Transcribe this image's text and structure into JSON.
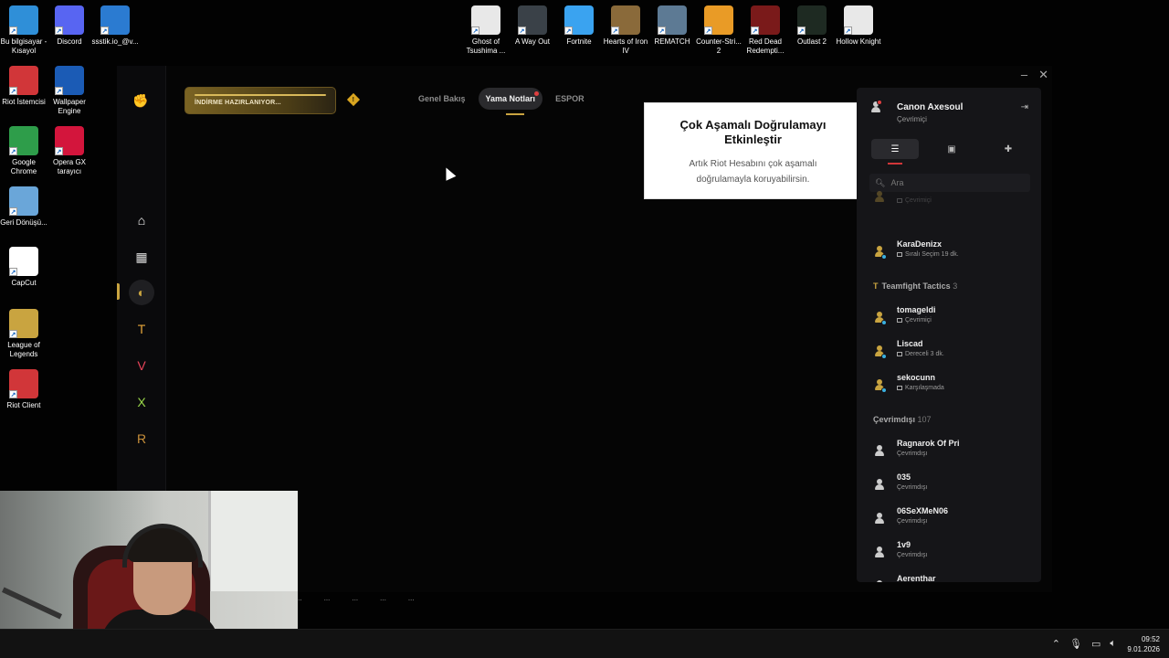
{
  "desktop": {
    "icons_left": [
      {
        "label": "Bu bilgisayar - Kısayol",
        "icon": "computer-icon",
        "color": "#2f8fd8"
      },
      {
        "label": "Discord",
        "icon": "discord-icon",
        "color": "#5865f2"
      },
      {
        "label": "ssstik.io_@v...",
        "icon": "video-file-icon",
        "color": "#2b7bd1"
      },
      {
        "label": "Riot İstemcisi",
        "icon": "riot-icon",
        "color": "#d13639"
      },
      {
        "label": "Wallpaper Engine",
        "icon": "wallpaper-engine-icon",
        "color": "#1b5bb5"
      },
      {
        "label": "Google Chrome",
        "icon": "chrome-icon",
        "color": "#2e9d4a"
      },
      {
        "label": "Opera GX tarayıcı",
        "icon": "opera-gx-icon",
        "color": "#d3153c"
      },
      {
        "label": "Geri Dönüşü...",
        "icon": "recycle-bin-icon",
        "color": "#6aa6d9"
      },
      {
        "label": "CapCut",
        "icon": "capcut-icon",
        "color": "#ffffff"
      },
      {
        "label": "League of Legends",
        "icon": "league-icon",
        "color": "#c9a440"
      },
      {
        "label": "Riot Client",
        "icon": "riot-icon",
        "color": "#d13639"
      }
    ],
    "icons_top": [
      {
        "label": "Ghost of Tsushima ...",
        "icon": "ghost-of-tsushima-icon",
        "color": "#e8e8e8"
      },
      {
        "label": "A Way Out",
        "icon": "a-way-out-icon",
        "color": "#3a4148"
      },
      {
        "label": "Fortnite",
        "icon": "fortnite-icon",
        "color": "#3aa3f0"
      },
      {
        "label": "Hearts of Iron IV",
        "icon": "hearts-of-iron-icon",
        "color": "#8a6a3a"
      },
      {
        "label": "REMATCH",
        "icon": "rematch-icon",
        "color": "#5d7a94"
      },
      {
        "label": "Counter-Stri... 2",
        "icon": "counter-strike-icon",
        "color": "#e99b26"
      },
      {
        "label": "Red Dead Redempti...",
        "icon": "red-dead-icon",
        "color": "#7a1a1a"
      },
      {
        "label": "Outlast 2",
        "icon": "outlast-icon",
        "color": "#1e2a22"
      },
      {
        "label": "Hollow Knight",
        "icon": "hollow-knight-icon",
        "color": "#e8e8e8"
      }
    ]
  },
  "client": {
    "play_button": "İNDİRME HAZIRLANIYOR...",
    "alert_glyph": "!",
    "tabs": [
      {
        "label": "Genel Bakış",
        "active": false,
        "dot": false
      },
      {
        "label": "Yama Notları",
        "active": true,
        "dot": true
      },
      {
        "label": "ESPOR",
        "active": false,
        "dot": false
      }
    ],
    "sidebar": [
      {
        "name": "home",
        "icon": "home-icon",
        "glyph": "⌂",
        "color": "#ffffff"
      },
      {
        "name": "library",
        "icon": "grid-icon",
        "glyph": "▦",
        "color": "#dddddd"
      },
      {
        "name": "league-of-legends",
        "icon": "league-icon",
        "glyph": "◐",
        "color": "#c9a440"
      },
      {
        "name": "teamfight-tactics",
        "icon": "tft-icon",
        "glyph": "T",
        "color": "#e5a53a"
      },
      {
        "name": "valorant",
        "icon": "valorant-icon",
        "glyph": "V",
        "color": "#e8445a"
      },
      {
        "name": "2xko",
        "icon": "2xko-icon",
        "glyph": "X",
        "color": "#9ad94a"
      },
      {
        "name": "legends-of-runeterra",
        "icon": "runeterra-icon",
        "glyph": "R",
        "color": "#c9903a"
      }
    ],
    "mfa_tooltip": {
      "title": "Çok Aşamalı Doğrulamayı Etkinleştir",
      "description": "Artık Riot Hesabını çok aşamalı doğrulamayla koruyabilirsin."
    },
    "bottom_strip": [
      "...",
      "...",
      "...",
      "...",
      "..."
    ]
  },
  "friends_panel": {
    "me": {
      "name": "Canon Axesoul",
      "status": "Çevrimiçi"
    },
    "search_placeholder": "Ara",
    "partial_top": {
      "name": "",
      "status": "Çevrimiçi"
    },
    "entries_a": [
      {
        "name": "KaraDenizx",
        "status": "Sıralı Seçim 19 dk.",
        "status_color": "#3ab0e0"
      }
    ],
    "group_tft": {
      "label": "Teamfight Tactics",
      "count": "3"
    },
    "entries_tft": [
      {
        "name": "tomageldi",
        "status": "Çevrimiçi",
        "status_color": "#3ab0e0"
      },
      {
        "name": "Liscad",
        "status": "Dereceli 3 dk.",
        "status_color": "#3ab0e0"
      },
      {
        "name": "sekocunn",
        "status": "Karşılaşmada",
        "status_color": "#3ab0e0"
      }
    ],
    "group_offline": {
      "label": "Çevrimdışı",
      "count": "107"
    },
    "entries_offline": [
      {
        "name": "Ragnarok Of Pri",
        "status": "Çevrimdışı"
      },
      {
        "name": "035",
        "status": "Çevrimdışı"
      },
      {
        "name": "06SeXMeN06",
        "status": "Çevrimdışı"
      },
      {
        "name": "1v9",
        "status": "Çevrimdışı"
      },
      {
        "name": "Aerenthar",
        "status": ""
      }
    ]
  },
  "taskbar": {
    "time": "09:52",
    "date": "9.01.2026"
  }
}
